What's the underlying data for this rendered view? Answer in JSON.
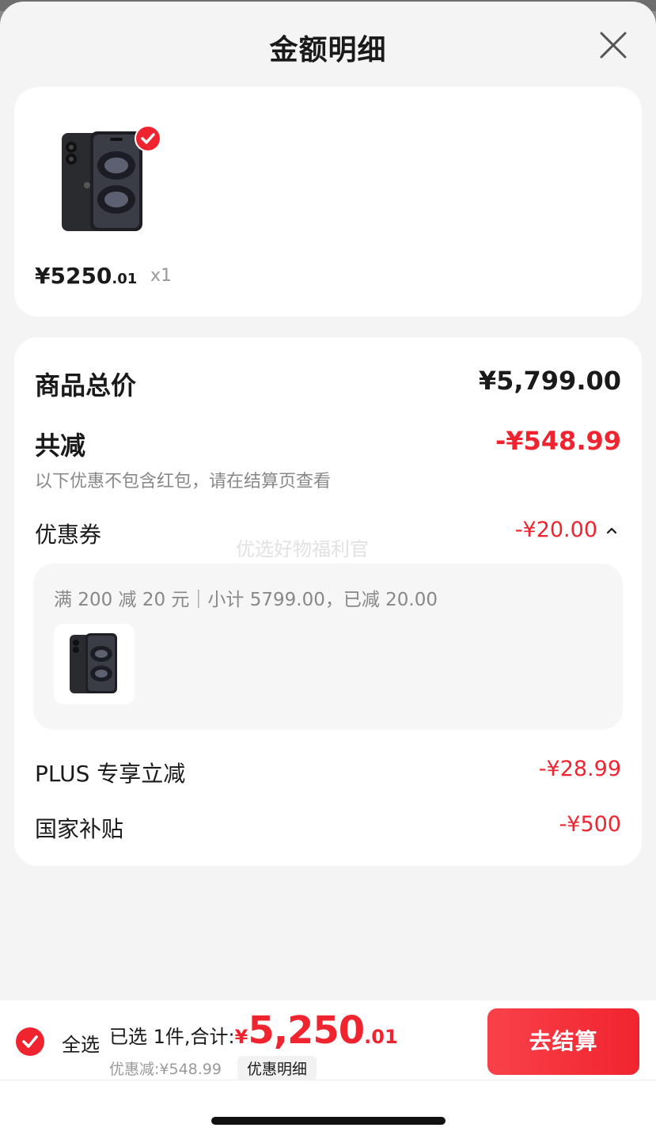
{
  "sheet": {
    "title": "金额明细"
  },
  "product": {
    "price_main": "¥5250",
    "price_decimal": ".01",
    "quantity": "x1",
    "selected": true
  },
  "detail": {
    "total_label": "商品总价",
    "total_value": "¥5,799.00",
    "reduce_label": "共减",
    "reduce_value": "-¥548.99",
    "reduce_note": "以下优惠不包含红包，请在结算页查看",
    "coupon_label": "优惠券",
    "coupon_value": "-¥20.00",
    "coupon_desc": "满 200 减 20 元｜小计 5799.00，已减 20.00",
    "watermark": "优选好物福利官",
    "plus_label": "PLUS 专享立减",
    "plus_value": "-¥28.99",
    "subsidy_label": "国家补贴",
    "subsidy_value": "-¥500"
  },
  "bottom": {
    "select_all": "全选",
    "summary_prefix": "已选 1件,合计:",
    "currency": "¥",
    "total_main": "5,250",
    "total_decimal": ".01",
    "discount": "优惠减:¥548.99",
    "detail_link": "优惠明细",
    "checkout": "去结算"
  },
  "colors": {
    "accent": "#f0242f",
    "text": "#1a1a1a",
    "muted": "#888888"
  }
}
